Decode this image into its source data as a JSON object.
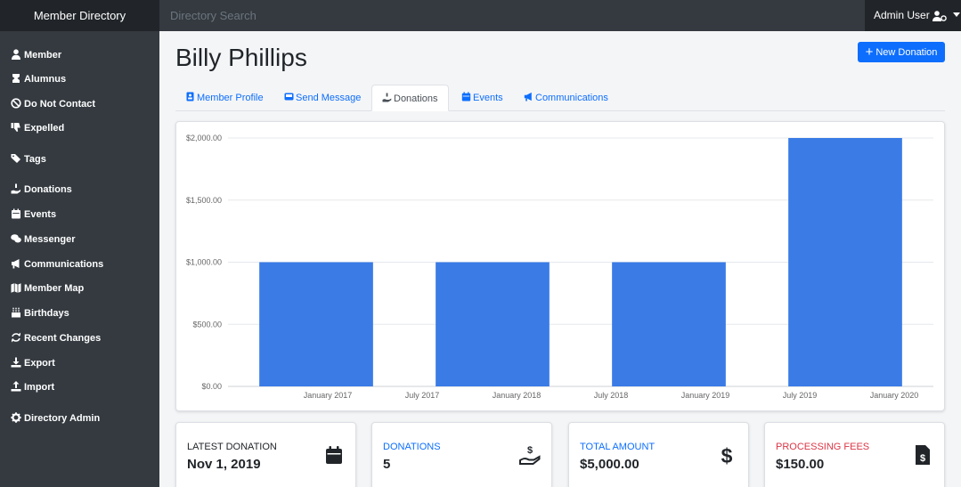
{
  "app": {
    "title": "Member Directory"
  },
  "search": {
    "placeholder": "Directory Search"
  },
  "user": {
    "name": "Admin User"
  },
  "sidebar": {
    "items": [
      {
        "label": "Member",
        "icon": "user-icon"
      },
      {
        "label": "Alumnus",
        "icon": "alumnus-icon"
      },
      {
        "label": "Do Not Contact",
        "icon": "ban-icon"
      },
      {
        "label": "Expelled",
        "icon": "thumbs-down-icon"
      },
      {
        "label": "Tags",
        "icon": "tags-icon"
      },
      {
        "label": "Donations",
        "icon": "hand-holding-usd-icon"
      },
      {
        "label": "Events",
        "icon": "calendar-icon"
      },
      {
        "label": "Messenger",
        "icon": "comments-icon"
      },
      {
        "label": "Communications",
        "icon": "bullhorn-icon"
      },
      {
        "label": "Member Map",
        "icon": "map-icon"
      },
      {
        "label": "Birthdays",
        "icon": "birthday-cake-icon"
      },
      {
        "label": "Recent Changes",
        "icon": "sync-icon"
      },
      {
        "label": "Export",
        "icon": "download-icon"
      },
      {
        "label": "Import",
        "icon": "upload-icon"
      },
      {
        "label": "Directory Admin",
        "icon": "cog-icon"
      }
    ]
  },
  "page": {
    "title": "Billy Phillips",
    "new_donation_label": "New Donation"
  },
  "tabs": [
    {
      "label": "Member Profile",
      "icon": "id-badge-icon",
      "active": false
    },
    {
      "label": "Send Message",
      "icon": "inbox-icon",
      "active": false
    },
    {
      "label": "Donations",
      "icon": "hand-holding-usd-icon",
      "active": true
    },
    {
      "label": "Events",
      "icon": "calendar-icon",
      "active": false
    },
    {
      "label": "Communications",
      "icon": "bullhorn-icon",
      "active": false
    }
  ],
  "chart_data": {
    "type": "bar",
    "title": "",
    "xlabel": "",
    "ylabel": "",
    "x_ticks": [
      "January 2017",
      "July 2017",
      "January 2018",
      "July 2018",
      "January 2019",
      "July 2019",
      "January 2020"
    ],
    "y_ticks": [
      "$0.00",
      "$500.00",
      "$1,000.00",
      "$1,500.00",
      "$2,000.00"
    ],
    "ylim": [
      0,
      2000
    ],
    "categories": [
      "2017",
      "2018",
      "2019",
      "2020"
    ],
    "values": [
      1000,
      1000,
      1000,
      2000
    ],
    "bar_color": "#3a7be6",
    "grid": true
  },
  "stats": [
    {
      "label": "Latest Donation",
      "value": "Nov 1, 2019",
      "label_color": "#212529",
      "icon": "calendar-icon"
    },
    {
      "label": "Donations",
      "value": "5",
      "label_color": "#0d6efd",
      "icon": "hand-holding-usd-icon"
    },
    {
      "label": "Total Amount",
      "value": "$5,000.00",
      "label_color": "#0d6efd",
      "icon": "dollar-sign-icon"
    },
    {
      "label": "Processing Fees",
      "value": "$150.00",
      "label_color": "#dc3545",
      "icon": "file-invoice-dollar-icon"
    }
  ]
}
